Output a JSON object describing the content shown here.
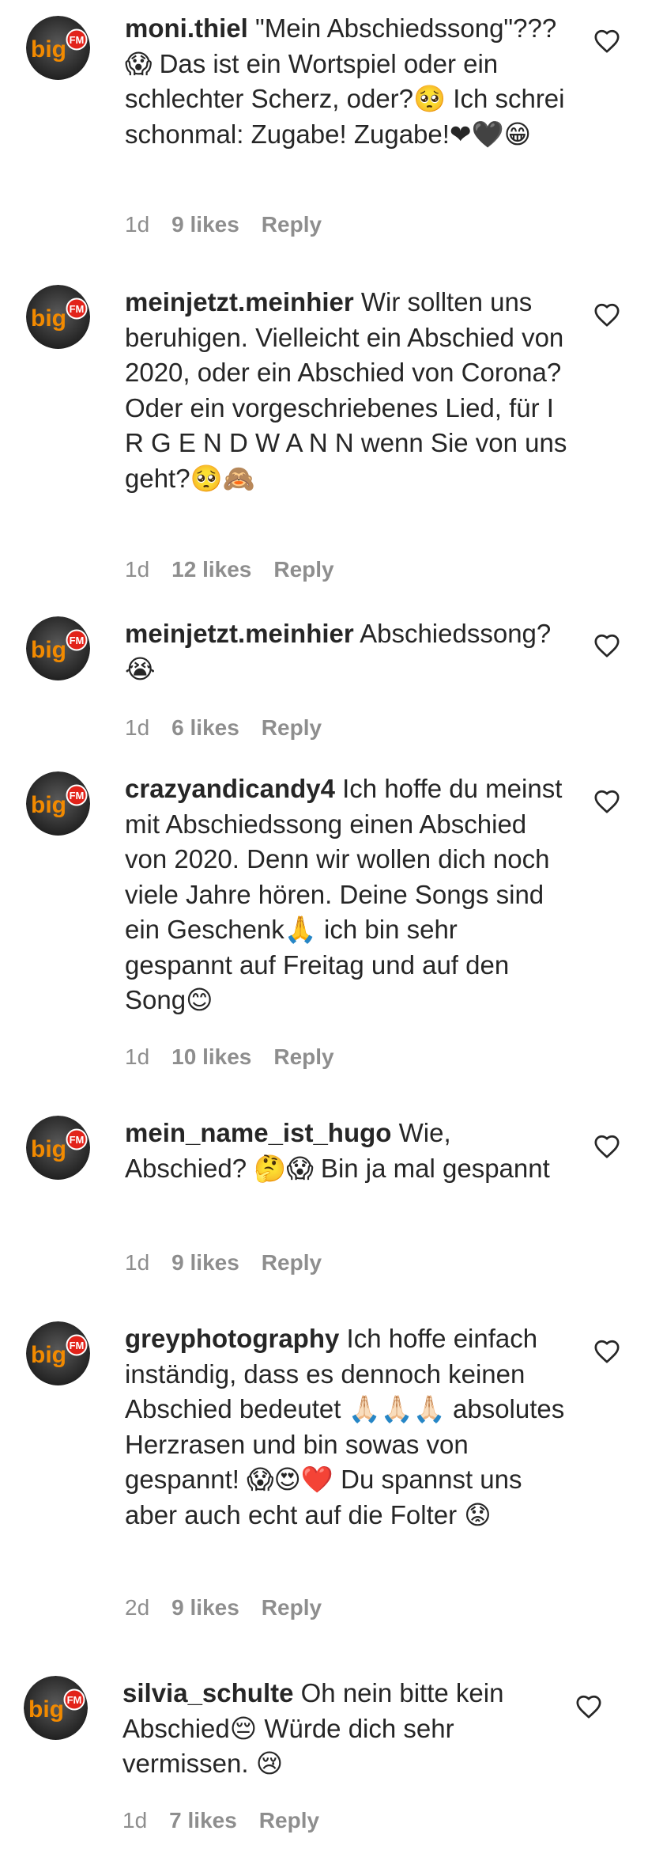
{
  "comments": [
    {
      "username": "moni.thiel",
      "text": "\"Mein Abschiedssong\"???😱 Das ist ein Wortspiel oder ein schlechter Scherz, oder?🥺 Ich schrei schonmal: Zugabe! Zugabe!❤🖤😁",
      "time": "1d",
      "likes": "9 likes",
      "reply": "Reply"
    },
    {
      "username": "meinjetzt.meinhier",
      "text": "Wir sollten uns beruhigen. Vielleicht ein Abschied von 2020, oder ein Abschied von Corona? Oder ein vorgeschriebenes Lied, für I R G E N D W A N N wenn Sie von uns geht?🥺🙈",
      "time": "1d",
      "likes": "12 likes",
      "reply": "Reply"
    },
    {
      "username": "meinjetzt.meinhier",
      "text": "Abschiedssong? 😭",
      "time": "1d",
      "likes": "6 likes",
      "reply": "Reply"
    },
    {
      "username": "crazyandicandy4",
      "text": "Ich hoffe du meinst mit Abschiedssong einen Abschied von 2020. Denn wir wollen dich noch viele Jahre hören. Deine Songs sind ein Geschenk🙏 ich bin sehr gespannt auf Freitag und auf den Song😊",
      "time": "1d",
      "likes": "10 likes",
      "reply": "Reply"
    },
    {
      "username": "mein_name_ist_hugo",
      "text": "Wie, Abschied? 🤔😱 Bin ja mal gespannt",
      "time": "1d",
      "likes": "9 likes",
      "reply": "Reply"
    },
    {
      "username": "greyphotography",
      "text": "Ich hoffe einfach inständig, dass es dennoch keinen Abschied bedeutet 🙏🏻🙏🏻🙏🏻 absolutes Herzrasen und bin sowas von gespannt! 😱😍❤️ Du spannst uns aber auch echt auf die Folter 😟",
      "time": "2d",
      "likes": "9 likes",
      "reply": "Reply"
    },
    {
      "username": "silvia_schulte",
      "text": "Oh nein bitte kein Abschied😔 Würde dich sehr vermissen. 😢",
      "time": "1d",
      "likes": "7 likes",
      "reply": "Reply"
    }
  ],
  "avatar_logo": {
    "big": "big",
    "fm": "FM"
  },
  "colors": {
    "text": "#262626",
    "meta": "#8e8e8e",
    "logo_orange": "#f28a00",
    "logo_fm_bg": "#e2231a"
  },
  "icons": {
    "like": "heart-outline-icon",
    "avatar": "bigfm-logo"
  }
}
